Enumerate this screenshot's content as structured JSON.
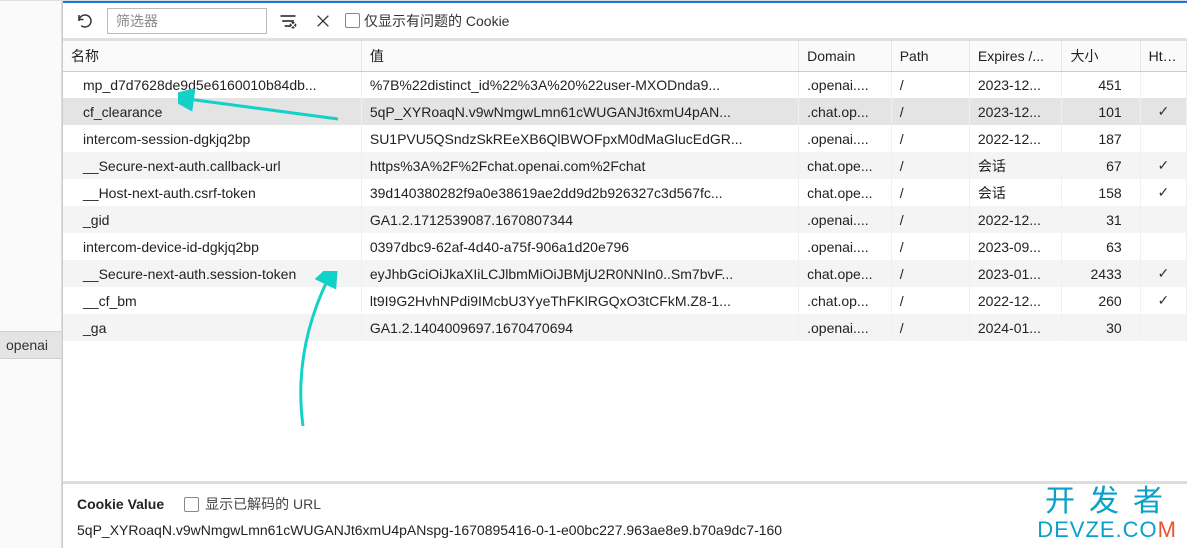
{
  "left": {
    "highlighted": "openai"
  },
  "toolbar": {
    "filter_placeholder": "筛选器",
    "problem_cookie_label": "仅显示有问题的 Cookie"
  },
  "columns": {
    "name": "名称",
    "value": "值",
    "domain": "Domain",
    "path": "Path",
    "expires": "Expires /...",
    "size": "大小",
    "http": "HttpO"
  },
  "rows": [
    {
      "name": "mp_d7d7628de9d5e6160010b84db...",
      "value": "%7B%22distinct_id%22%3A%20%22user-MXODnda9...",
      "domain": ".openai....",
      "path": "/",
      "expires": "2023-12...",
      "size": "451",
      "http": ""
    },
    {
      "name": "cf_clearance",
      "value": "5qP_XYRoaqN.v9wNmgwLmn61cWUGANJt6xmU4pAN...",
      "domain": ".chat.op...",
      "path": "/",
      "expires": "2023-12...",
      "size": "101",
      "http": "✓",
      "selected": true
    },
    {
      "name": "intercom-session-dgkjq2bp",
      "value": "SU1PVU5QSndzSkREeXB6QlBWOFpxM0dMaGlucEdGR...",
      "domain": ".openai....",
      "path": "/",
      "expires": "2022-12...",
      "size": "187",
      "http": ""
    },
    {
      "name": "__Secure-next-auth.callback-url",
      "value": "https%3A%2F%2Fchat.openai.com%2Fchat",
      "domain": "chat.ope...",
      "path": "/",
      "expires": "会话",
      "size": "67",
      "http": "✓"
    },
    {
      "name": "__Host-next-auth.csrf-token",
      "value": "39d140380282f9a0e38619ae2dd9d2b926327c3d567fc...",
      "domain": "chat.ope...",
      "path": "/",
      "expires": "会话",
      "size": "158",
      "http": "✓"
    },
    {
      "name": "_gid",
      "value": "GA1.2.1712539087.1670807344",
      "domain": ".openai....",
      "path": "/",
      "expires": "2022-12...",
      "size": "31",
      "http": ""
    },
    {
      "name": "intercom-device-id-dgkjq2bp",
      "value": "0397dbc9-62af-4d40-a75f-906a1d20e796",
      "domain": ".openai....",
      "path": "/",
      "expires": "2023-09...",
      "size": "63",
      "http": ""
    },
    {
      "name": "__Secure-next-auth.session-token",
      "value": "eyJhbGciOiJkaXIiLCJlbmMiOiJBMjU2R0NNIn0..Sm7bvF...",
      "domain": "chat.ope...",
      "path": "/",
      "expires": "2023-01...",
      "size": "2433",
      "http": "✓"
    },
    {
      "name": "__cf_bm",
      "value": "lt9I9G2HvhNPdi9IMcbU3YyeThFKlRGQxO3tCFkM.Z8-1...",
      "domain": ".chat.op...",
      "path": "/",
      "expires": "2022-12...",
      "size": "260",
      "http": "✓"
    },
    {
      "name": "_ga",
      "value": "GA1.2.1404009697.1670470694",
      "domain": ".openai....",
      "path": "/",
      "expires": "2024-01...",
      "size": "30",
      "http": ""
    }
  ],
  "detail": {
    "key": "Cookie Value",
    "decoded_label": "显示已解码的 URL",
    "value": "5qP_XYRoaqN.v9wNmgwLmn61cWUGANJt6xmU4pANspg-1670895416-0-1-e00bc227.963ae8e9.b70a9dc7-160"
  },
  "watermark": {
    "line1": "开发者",
    "line2_pre": "DEVZE.CO",
    "line2_suf": "M"
  }
}
